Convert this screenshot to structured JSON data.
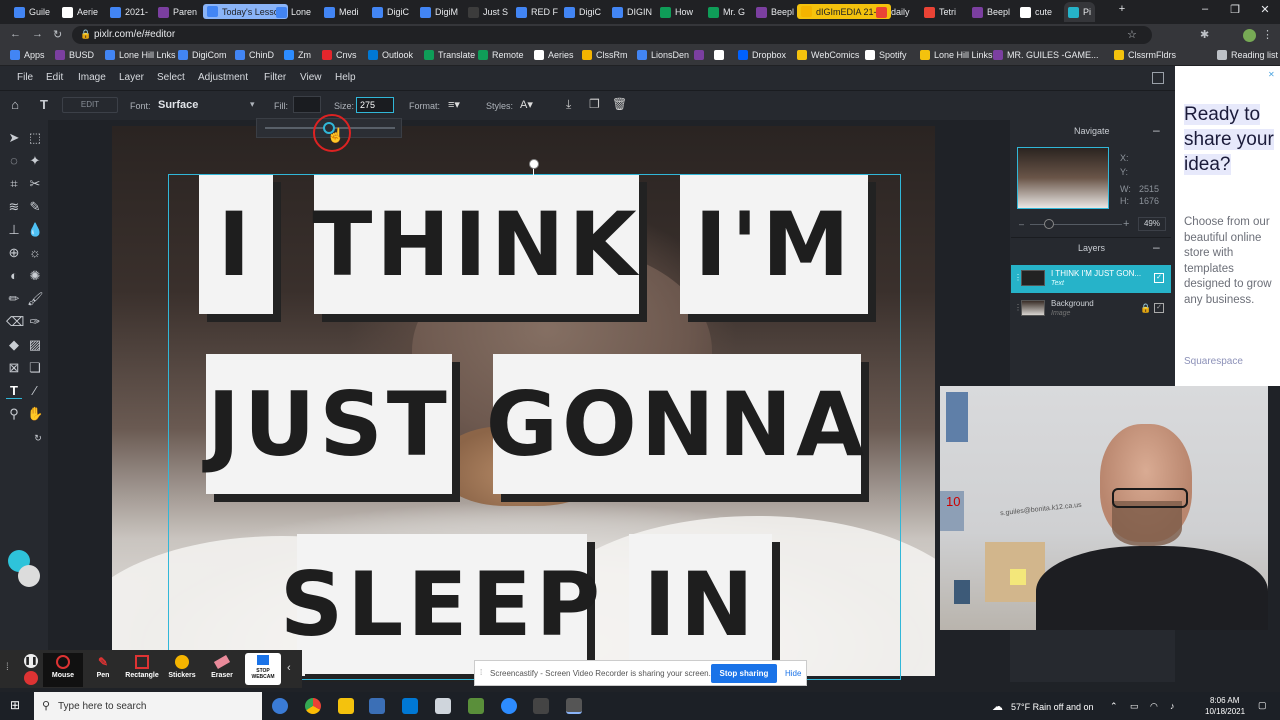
{
  "browser": {
    "tabs": [
      {
        "label": "Guile",
        "color": "#4285f4"
      },
      {
        "label": "Aerie",
        "color": "#ffffff"
      },
      {
        "label": "2021-",
        "color": "#4285f4"
      },
      {
        "label": "Paren",
        "color": "#7b3fa0"
      },
      {
        "label": "Today's Lesson",
        "color": "#4285f4"
      },
      {
        "label": "Lone",
        "color": "#4285f4"
      },
      {
        "label": "Medi",
        "color": "#4285f4"
      },
      {
        "label": "DigiC",
        "color": "#4285f4"
      },
      {
        "label": "DigiM",
        "color": "#4285f4"
      },
      {
        "label": "Just S",
        "color": "#3c3c3c"
      },
      {
        "label": "RED F",
        "color": "#4285f4"
      },
      {
        "label": "DigiC",
        "color": "#4285f4"
      },
      {
        "label": "DIGIN",
        "color": "#4285f4"
      },
      {
        "label": "How",
        "color": "#0f9d58"
      },
      {
        "label": "Mr. G",
        "color": "#0f9d58"
      },
      {
        "label": "Beepl",
        "color": "#7b3fa0"
      },
      {
        "label": "dIGImEDIA 21-22",
        "color": "#f4b400"
      },
      {
        "label": "daily",
        "color": "#ea4335"
      },
      {
        "label": "Tetri",
        "color": "#ea4335"
      },
      {
        "label": "Beepl",
        "color": "#7b3fa0"
      },
      {
        "label": "cute",
        "color": "#ffffff"
      },
      {
        "label": "Pi",
        "color": "#26b3c9"
      }
    ],
    "url": "pixlr.com/e/#editor",
    "bookmarks": [
      {
        "label": "Apps",
        "color": "#4285f4"
      },
      {
        "label": "BUSD",
        "color": "#7b3fa0"
      },
      {
        "label": "Lone Hill Lnks",
        "color": "#4285f4"
      },
      {
        "label": "DigiCom",
        "color": "#4285f4"
      },
      {
        "label": "ChinD",
        "color": "#4285f4"
      },
      {
        "label": "Zm",
        "color": "#2d8cff"
      },
      {
        "label": "Cnvs",
        "color": "#e4262c"
      },
      {
        "label": "Outlook",
        "color": "#0078d4"
      },
      {
        "label": "Translate",
        "color": "#0f9d58"
      },
      {
        "label": "Remote",
        "color": "#0f9d58"
      },
      {
        "label": "Aeries",
        "color": "#ffffff"
      },
      {
        "label": "ClssRm",
        "color": "#f4b400"
      },
      {
        "label": "LionsDen",
        "color": "#4285f4"
      },
      {
        "label": "",
        "color": "#7b3fa0"
      },
      {
        "label": "",
        "color": "#ffffff"
      },
      {
        "label": "Dropbox",
        "color": "#0061ff"
      },
      {
        "label": "WebComics",
        "color": "#f4c20d"
      },
      {
        "label": "Spotify",
        "color": "#ffffff"
      },
      {
        "label": "Lone Hill Links",
        "color": "#f4c20d"
      },
      {
        "label": "MR. GUILES -GAME...",
        "color": "#7b3fa0"
      },
      {
        "label": "ClssrmFldrs",
        "color": "#f4c20d"
      },
      {
        "label": "Reading list",
        "color": "#bdc1c6"
      }
    ]
  },
  "editor": {
    "menu": [
      "File",
      "Edit",
      "Image",
      "Layer",
      "Select",
      "Adjustment",
      "Filter",
      "View",
      "Help"
    ],
    "options": {
      "edit_label": "EDIT",
      "font_label": "Font:",
      "font_value": "Surface",
      "fill_label": "Fill:",
      "size_label": "Size:",
      "size_value": "275",
      "format_label": "Format:",
      "styles_label": "Styles:"
    },
    "canvas_words": [
      "I",
      "THINK",
      "I'M",
      "JUST",
      "GONNA",
      "SLEEP",
      "IN"
    ],
    "navigate": {
      "title": "Navigate",
      "x_label": "X:",
      "y_label": "Y:",
      "w_label": "W:",
      "w_value": "2515",
      "h_label": "H:",
      "h_value": "1676",
      "zoom": "49%"
    },
    "layers": {
      "title": "Layers",
      "items": [
        {
          "name": "I THINK I'M JUST GON...",
          "type": "Text"
        },
        {
          "name": "Background",
          "type": "Image"
        }
      ]
    }
  },
  "ad": {
    "headline": "Ready to share your idea?",
    "body": "Choose from our beautiful online store with templates designed to grow any business.",
    "brand": "Squarespace"
  },
  "webcam": {
    "note": "s.guiles@bonita.k12.ca.us"
  },
  "screencastify": {
    "tools": [
      "Mouse",
      "Pen",
      "Rectangle",
      "Stickers",
      "Eraser",
      "STOP WEBCAM"
    ],
    "share_message": "Screencastify - Screen Video Recorder is sharing your screen.",
    "stop_label": "Stop sharing",
    "hide_label": "Hide"
  },
  "taskbar": {
    "search_placeholder": "Type here to search",
    "weather": "57°F  Rain off and on",
    "time": "8:06 AM",
    "date": "10/18/2021"
  }
}
